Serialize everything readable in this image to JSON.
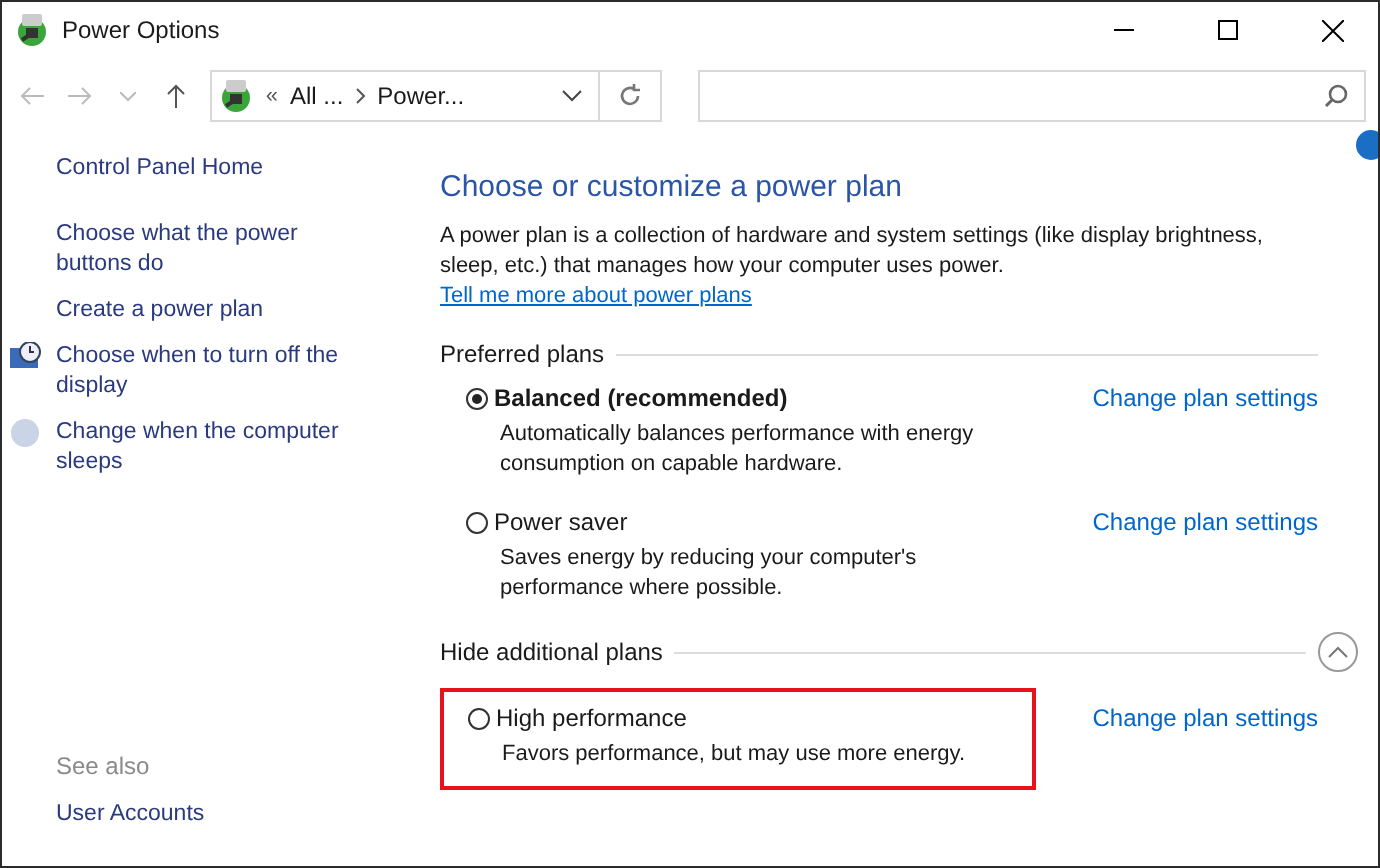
{
  "window": {
    "title": "Power Options"
  },
  "address": {
    "overflow": "«",
    "crumbs": [
      "All ...",
      "Power..."
    ]
  },
  "sidebar": {
    "items": [
      {
        "label": "Control Panel Home",
        "kind": "plain"
      },
      {
        "label": "Choose what the power buttons do",
        "kind": "plain"
      },
      {
        "label": "Create a power plan",
        "kind": "plain"
      },
      {
        "label": "Choose when to turn off the display",
        "kind": "display"
      },
      {
        "label": "Change when the computer sleeps",
        "kind": "sleep"
      }
    ],
    "see_also": {
      "heading": "See also",
      "links": [
        "User Accounts"
      ]
    }
  },
  "main": {
    "heading": "Choose or customize a power plan",
    "intro": "A power plan is a collection of hardware and system settings (like display brightness, sleep, etc.) that manages how your computer uses power.",
    "intro_link": "Tell me more about power plans",
    "groups": [
      {
        "title": "Preferred plans",
        "collapsible": false,
        "plans": [
          {
            "name": "Balanced (recommended)",
            "description": "Automatically balances performance with energy consumption on capable hardware.",
            "selected": true,
            "highlighted": false,
            "link": "Change plan settings"
          },
          {
            "name": "Power saver",
            "description": "Saves energy by reducing your computer's performance where possible.",
            "selected": false,
            "highlighted": false,
            "link": "Change plan settings"
          }
        ]
      },
      {
        "title": "Hide additional plans",
        "collapsible": true,
        "expanded": true,
        "plans": [
          {
            "name": "High performance",
            "description": "Favors performance, but may use more energy.",
            "selected": false,
            "highlighted": true,
            "link": "Change plan settings"
          }
        ]
      }
    ]
  }
}
